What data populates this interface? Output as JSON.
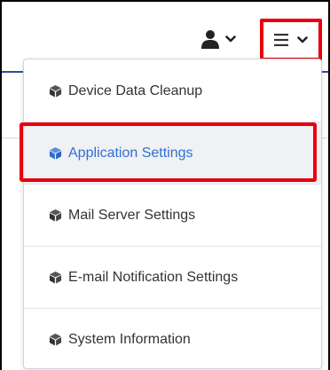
{
  "header": {
    "user_icon": "user-icon",
    "menu_icon": "hamburger-menu-icon",
    "caret_icon": "chevron-down-icon"
  },
  "menu": {
    "items": [
      {
        "label": "Device Data Cleanup",
        "icon": "cube-icon"
      },
      {
        "label": "Application Settings",
        "icon": "cube-icon",
        "active": true
      },
      {
        "label": "Mail Server Settings",
        "icon": "cube-icon"
      },
      {
        "label": "E-mail Notification Settings",
        "icon": "cube-icon"
      },
      {
        "label": "System Information",
        "icon": "cube-icon"
      }
    ]
  },
  "colors": {
    "highlight": "#e8000b",
    "accent": "#2f6fd6",
    "nav_underline": "#2f4aa8"
  }
}
